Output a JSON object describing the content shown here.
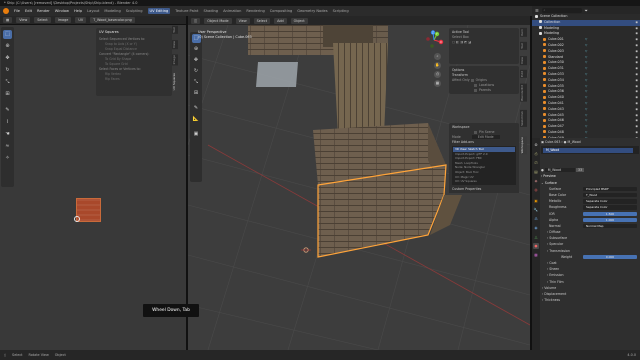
{
  "window": {
    "title": "* Ship (C:\\Users\\ [removed] \\Desktop\\Projects\\Ship\\Ship.blend) - Blender 4.0"
  },
  "menu": {
    "logo_icon": "blender-logo-icon",
    "file": "File",
    "edit": "Edit",
    "render": "Render",
    "window": "Window",
    "help": "Help",
    "workspaces": [
      "Layout",
      "Modeling",
      "Sculpting",
      "UV Editing",
      "Texture Paint",
      "Shading",
      "Animation",
      "Rendering",
      "Compositing",
      "Geometry Nodes",
      "Scripting"
    ],
    "active_workspace": "UV Editing",
    "scene": "Scene",
    "view_layer": "ViewLayer"
  },
  "uv_editor": {
    "view": "View",
    "select": "Select",
    "image": "Image",
    "uv": "UV",
    "image_name": "T_Wood_basecolor.png",
    "panel_title": "UV Squares",
    "panel_rows": [
      "Select Sequenced Vertices to:",
      "Snap to Axis (X or Y)",
      "Snap Equal Distance",
      "Convert \"Rectangle\" (4 corners):",
      "To Grid By Shape",
      "To Square Grid",
      "Select Faces or Vertices to:",
      "Rip Vertex",
      "Rip Faces"
    ],
    "tabs": [
      "Tool",
      "View",
      "Image",
      "UV Squares"
    ]
  },
  "viewport": {
    "mode": "Object Mode",
    "view": "View",
    "select": "Select",
    "add": "Add",
    "object": "Object",
    "overlay_line1": "User Perspective",
    "overlay_line2": "(0) Scene Collection | Cube.063",
    "active_tool_title": "Active Tool",
    "active_tool_value": "Select Box",
    "options_title": "Options",
    "transform_label": "Transform",
    "affect_only": "Affect Only",
    "origins": "Origins",
    "locations": "Locations",
    "parents": "Parents",
    "workspace_title": "Workspace",
    "pin_scene": "Pin Scene",
    "mode_label": "Mode",
    "mode_value": "Edit Mode",
    "filter_addons": "Filter Add-ons",
    "addon_list": [
      "3D View: Sketch Tool",
      "Import-Export: glTF 2.0",
      "Import-Export: FBX",
      "Mesh: LoopTools",
      "Node: Node Wrangler",
      "Object: Bool Tool",
      "UV: Magic UV",
      "UV: UV Squares",
      "Render: Cycles",
      "Interface: Copy Attributes"
    ],
    "custom_properties": "Custom Properties",
    "n_tabs": [
      "Item",
      "Tool",
      "View",
      "Edit",
      "BlenderKit",
      "Sketchfab",
      "Workspace"
    ],
    "gizmo_x": "X",
    "gizmo_y": "Y",
    "gizmo_z": "Z"
  },
  "tooltip": {
    "text": "Wheel Down, Tab"
  },
  "outliner": {
    "search_placeholder": "",
    "root": "Scene Collection",
    "rows": [
      {
        "name": "Collection",
        "type": "collection"
      },
      {
        "name": "Modeling",
        "type": "collection"
      },
      {
        "name": "Modeling",
        "type": "collection"
      },
      {
        "name": "Cube.001",
        "type": "mesh"
      },
      {
        "name": "Cube.002",
        "type": "mesh"
      },
      {
        "name": "Cube.003",
        "type": "mesh"
      },
      {
        "name": "Standard",
        "type": "mesh"
      },
      {
        "name": "Cube.030",
        "type": "mesh"
      },
      {
        "name": "Cube.031",
        "type": "mesh"
      },
      {
        "name": "Cube.033",
        "type": "mesh"
      },
      {
        "name": "Cube.034",
        "type": "mesh"
      },
      {
        "name": "Cube.035",
        "type": "mesh"
      },
      {
        "name": "Cube.036",
        "type": "mesh"
      },
      {
        "name": "Cube.040",
        "type": "mesh"
      },
      {
        "name": "Cube.041",
        "type": "mesh"
      },
      {
        "name": "Cube.043",
        "type": "mesh"
      },
      {
        "name": "Cube.045",
        "type": "mesh"
      },
      {
        "name": "Cube.046",
        "type": "mesh"
      },
      {
        "name": "Cube.047",
        "type": "mesh"
      },
      {
        "name": "Cube.048",
        "type": "mesh"
      },
      {
        "name": "Cube.049",
        "type": "mesh"
      },
      {
        "name": "Cube.050",
        "type": "mesh"
      }
    ],
    "selected_index": 0
  },
  "properties": {
    "object_name": "Cube.063",
    "material_crumb": "M_Wood",
    "material_slot": "M_Wood",
    "material_name": "M_Wood",
    "user_count": "33",
    "preview": "Preview",
    "surface_section": "Surface",
    "rows": [
      {
        "label": "Surface",
        "value": "Principled BSDF",
        "style": "dark"
      },
      {
        "label": "Base Color",
        "value": "T_Wood",
        "style": "dark"
      },
      {
        "label": "Metallic",
        "value": "Separate Color",
        "style": "dark"
      },
      {
        "label": "Roughness",
        "value": "Separate Color",
        "style": "dark"
      },
      {
        "label": "IOR",
        "value": "1.500",
        "style": "blue"
      },
      {
        "label": "Alpha",
        "value": "1.000",
        "style": "blue"
      },
      {
        "label": "Normal",
        "value": "Normal Map",
        "style": "dark"
      }
    ],
    "sub_sections": [
      "Diffuse",
      "Subsurface",
      "Specular",
      "Transmission"
    ],
    "weight_label": "Weight",
    "weight_value": "0.000",
    "more_sections": [
      "Coat",
      "Sheen",
      "Emission",
      "Thin Film"
    ],
    "bottom_sections": [
      "Volume",
      "Displacement",
      "Thickness"
    ]
  },
  "status": {
    "select": "Select",
    "rotate": "Rotate View",
    "object": "Object",
    "version": "4.0.0"
  },
  "colors": {
    "accent_blue": "#4772b3",
    "selection_orange": "#ffa43a",
    "blender_orange": "#e87d0d"
  }
}
